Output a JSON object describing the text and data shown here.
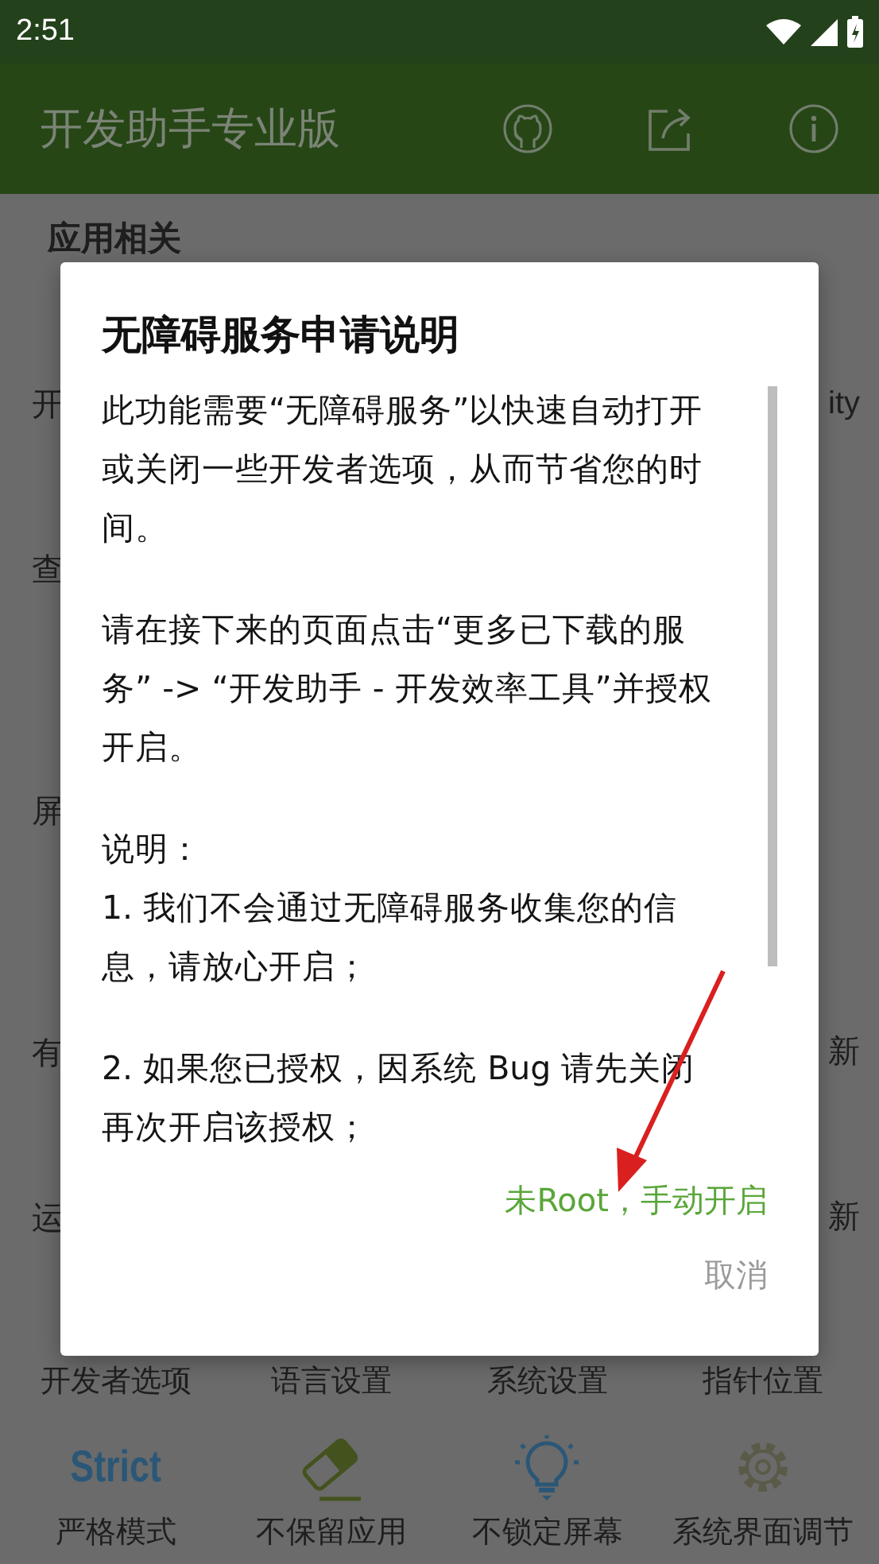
{
  "status_bar": {
    "time": "2:51"
  },
  "app_bar": {
    "title": "开发助手专业版"
  },
  "background_rows": [
    {
      "kind": "heading",
      "left": "应用相关"
    },
    {
      "kind": "item",
      "left": "开",
      "right": "ity"
    },
    {
      "kind": "item",
      "left": "查"
    },
    {
      "kind": "item_after_section",
      "left": "屏"
    },
    {
      "kind": "item_after_section",
      "left": "有",
      "right": "新"
    },
    {
      "kind": "item",
      "left": "运",
      "right": "新"
    }
  ],
  "shortcut_labels": [
    "开发者选项",
    "语言设置",
    "系统设置",
    "指针位置"
  ],
  "tools": [
    {
      "kind": "text",
      "icon_text": "Strict",
      "label": "严格模式"
    },
    {
      "kind": "eraser",
      "label": "不保留应用"
    },
    {
      "kind": "bulb",
      "label": "不锁定屏幕"
    },
    {
      "kind": "gear",
      "label": "系统界面调节"
    }
  ],
  "dialog": {
    "title": "无障碍服务申请说明",
    "paragraphs": [
      [
        "此功能需要“无障碍服务”以快速自动打开或关闭一些开发者选项，从而节省您的时间。"
      ],
      [
        "请在接下来的页面点击“更多已下载的服务” -> “开发助手 - 开发效率工具”并授权开启。"
      ],
      [
        "说明：",
        "1. 我们不会通过无障碍服务收集您的信息，请放心开启；"
      ],
      [
        "2. 如果您已授权，因系统 Bug 请先关闭再次开启该授权；"
      ]
    ],
    "buttons": [
      {
        "kind": "primary",
        "label": "未Root，手动开启"
      },
      {
        "kind": "secondary",
        "label": "取消"
      }
    ]
  }
}
